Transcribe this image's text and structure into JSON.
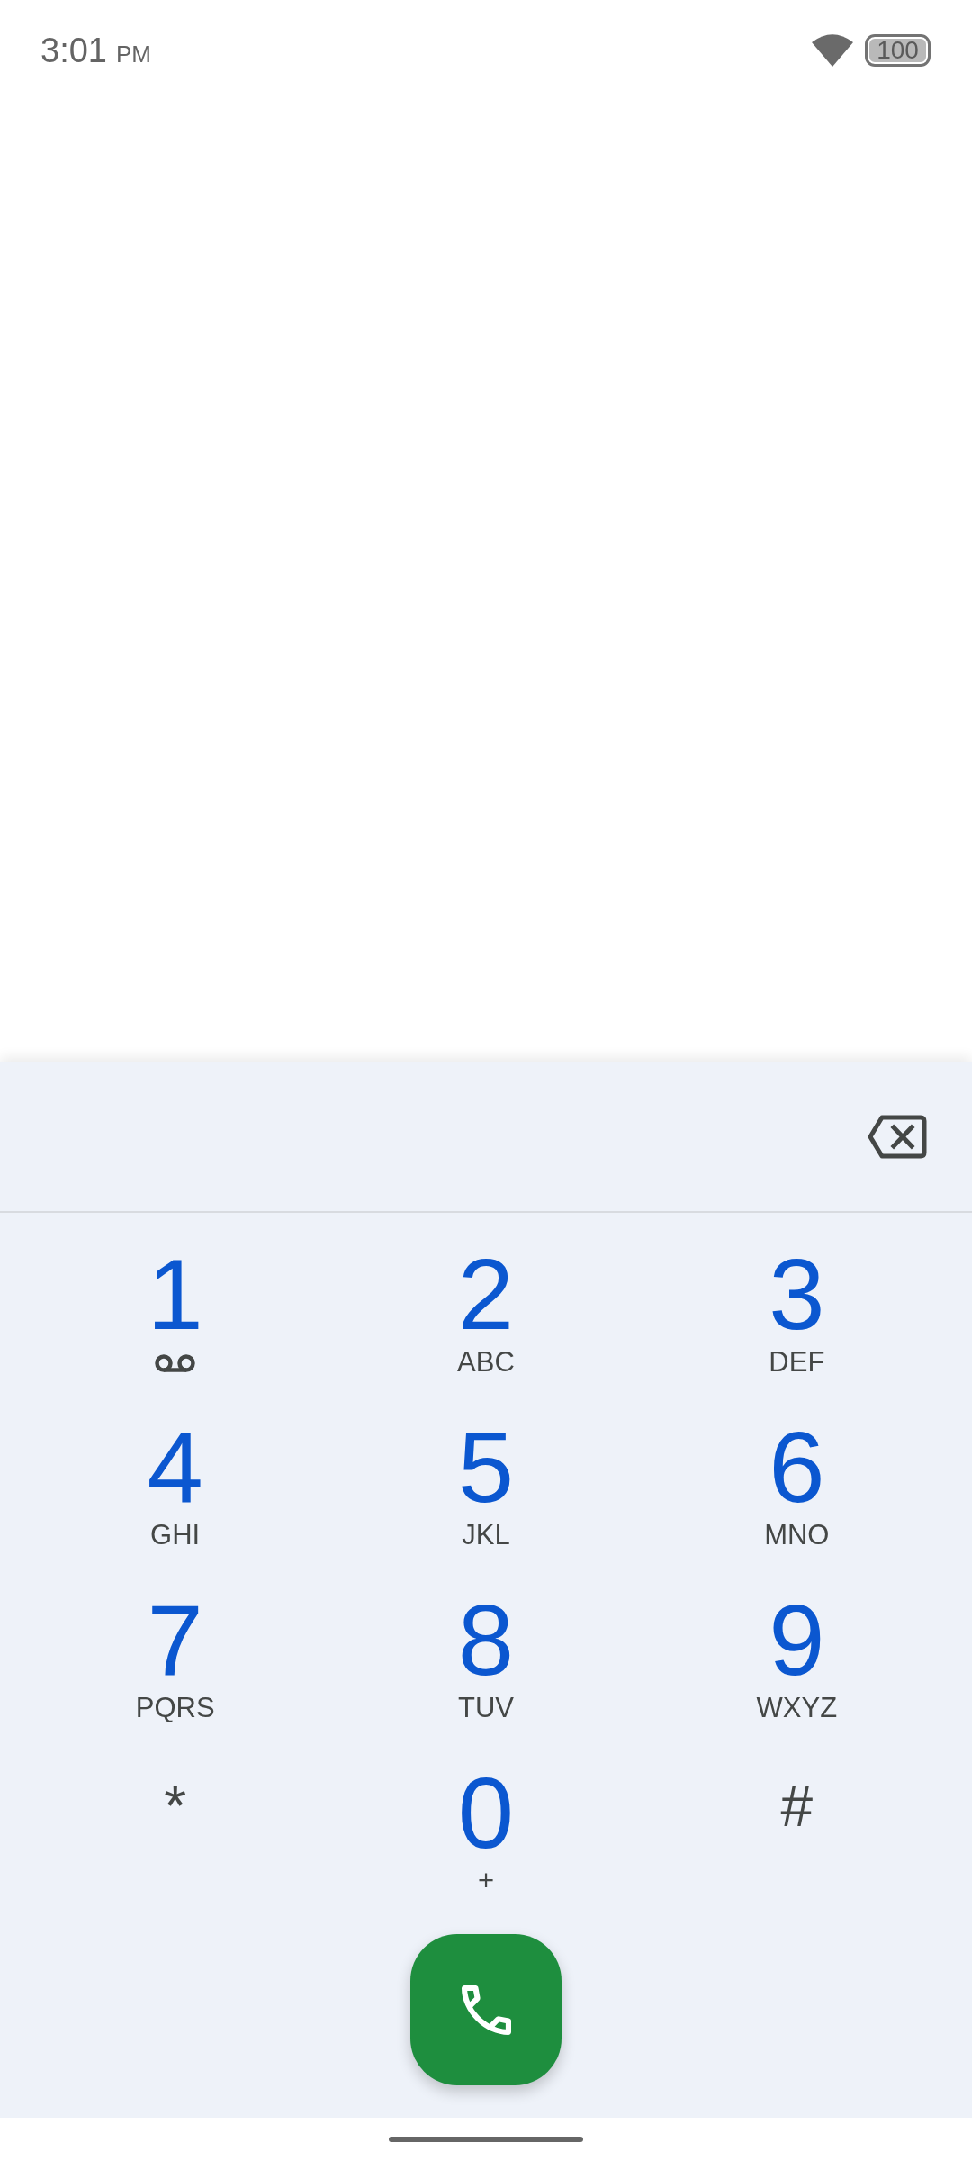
{
  "status_bar": {
    "time": "3:01",
    "period": "PM",
    "battery": "100"
  },
  "dialpad": {
    "keys": [
      {
        "kind": "voicemail",
        "digit": "1"
      },
      {
        "kind": "letters",
        "digit": "2",
        "letters": "ABC"
      },
      {
        "kind": "letters",
        "digit": "3",
        "letters": "DEF"
      },
      {
        "kind": "letters",
        "digit": "4",
        "letters": "GHI"
      },
      {
        "kind": "letters",
        "digit": "5",
        "letters": "JKL"
      },
      {
        "kind": "letters",
        "digit": "6",
        "letters": "MNO"
      },
      {
        "kind": "letters",
        "digit": "7",
        "letters": "PQRS"
      },
      {
        "kind": "letters",
        "digit": "8",
        "letters": "TUV"
      },
      {
        "kind": "letters",
        "digit": "9",
        "letters": "WXYZ"
      },
      {
        "kind": "symbol",
        "digit": "*"
      },
      {
        "kind": "letters",
        "digit": "0",
        "letters": "+"
      },
      {
        "kind": "symbol",
        "digit": "#"
      }
    ]
  }
}
